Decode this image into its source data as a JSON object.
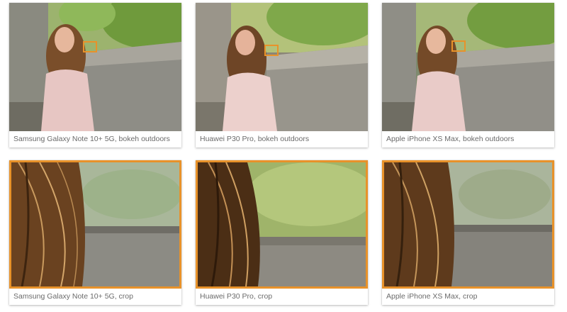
{
  "gallery": {
    "items": [
      {
        "caption": "Samsung Galaxy Note 10+ 5G, bokeh outdoors",
        "image": "portrait-woman-stone-wall"
      },
      {
        "caption": "Huawei P30 Pro, bokeh outdoors",
        "image": "portrait-woman-stone-wall"
      },
      {
        "caption": "Apple iPhone XS Max, bokeh outdoors",
        "image": "portrait-woman-stone-wall"
      },
      {
        "caption": "Samsung Galaxy Note 10+ 5G, crop",
        "image": "hair-crop-closeup"
      },
      {
        "caption": "Huawei P30 Pro, crop",
        "image": "hair-crop-closeup"
      },
      {
        "caption": "Apple iPhone XS Max, crop",
        "image": "hair-crop-closeup"
      }
    ],
    "colors": {
      "crop_highlight": "#e8922a",
      "caption_text": "#6b6b6b"
    }
  }
}
